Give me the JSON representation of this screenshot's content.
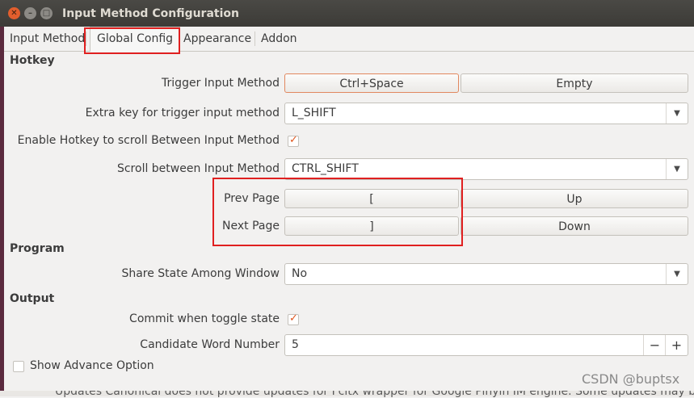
{
  "window": {
    "title": "Input Method Configuration"
  },
  "tabs": [
    {
      "label": "Input Method"
    },
    {
      "label": "Global Config"
    },
    {
      "label": "Appearance"
    },
    {
      "label": "Addon"
    }
  ],
  "hotkey": {
    "section": "Hotkey",
    "trigger_label": "Trigger Input Method",
    "trigger_primary": "Ctrl+Space",
    "trigger_secondary": "Empty",
    "extra_key_label": "Extra key for trigger input method",
    "extra_key_value": "L_SHIFT",
    "enable_scroll_label": "Enable Hotkey to scroll Between Input Method",
    "enable_scroll_checked": true,
    "scroll_between_label": "Scroll between Input Method",
    "scroll_between_value": "CTRL_SHIFT",
    "prev_page_label": "Prev Page",
    "prev_page_primary": "[",
    "prev_page_secondary": "Up",
    "next_page_label": "Next Page",
    "next_page_primary": "]",
    "next_page_secondary": "Down"
  },
  "program": {
    "section": "Program",
    "share_state_label": "Share State Among Window",
    "share_state_value": "No"
  },
  "output": {
    "section": "Output",
    "commit_label": "Commit when toggle state",
    "commit_checked": true,
    "candidate_label": "Candidate Word Number",
    "candidate_value": "5",
    "minus": "−",
    "plus": "+"
  },
  "footer": {
    "show_advance_label": "Show Advance Option",
    "background_text": "Updates    Canonical does not provide updates for Fcitx wrapper for Google Pinyin IM engine. Some updates may be pr",
    "watermark": "CSDN @buptsx"
  },
  "icons": {
    "close": "close-icon",
    "minimize": "minimize-icon",
    "maximize": "maximize-icon",
    "dropdown": "chevron-down-icon",
    "check": "checkmark-icon"
  },
  "colors": {
    "titlebar": "#3c3b37",
    "close_button": "#e25e2d",
    "check_accent": "#e0561f",
    "annotation": "#e02020"
  }
}
